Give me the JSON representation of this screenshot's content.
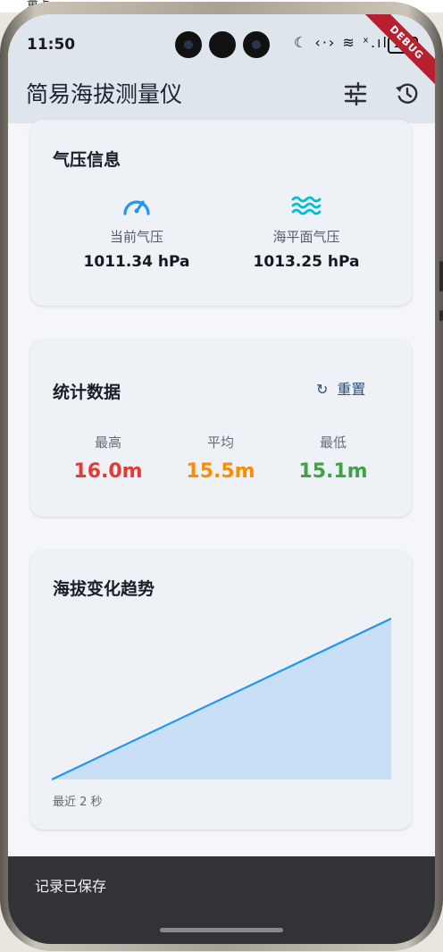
{
  "top_edge_text": "量上",
  "status_bar": {
    "time": "11:50",
    "icons": "☾ ‹·› ≋ ˣ.ıl",
    "battery": "100"
  },
  "app_bar": {
    "title": "简易海拔测量仪",
    "debug_banner": "DEBUG",
    "tune_icon": "tune-icon",
    "history_icon": "history-icon"
  },
  "pressure_card": {
    "title": "气压信息",
    "current": {
      "label": "当前气压",
      "value": "1011.34 hPa",
      "icon": "speedometer-icon",
      "color": "#2196f3"
    },
    "sea_level": {
      "label": "海平面气压",
      "value": "1013.25 hPa",
      "icon": "waves-icon",
      "color": "#00bcd4"
    }
  },
  "stats_card": {
    "title": "统计数据",
    "reset_label": "重置",
    "items": [
      {
        "label": "最高",
        "value": "16.0m",
        "color": "#e53935"
      },
      {
        "label": "平均",
        "value": "15.5m",
        "color": "#fb8c00"
      },
      {
        "label": "最低",
        "value": "15.1m",
        "color": "#43a047"
      }
    ]
  },
  "trend_card": {
    "title": "海拔变化趋势",
    "caption": "最近 2 秒",
    "line_color": "#2196f3",
    "fill_color": "#c8dff5"
  },
  "chart_data": {
    "type": "area",
    "title": "海拔变化趋势",
    "xlabel": "最近 2 秒",
    "ylabel": "",
    "x": [
      0,
      1
    ],
    "series": [
      {
        "values": [
          15.1,
          16.0
        ]
      }
    ],
    "ylim": [
      15.1,
      16.0
    ],
    "grid": false
  },
  "snackbar": {
    "message": "记录已保存"
  }
}
